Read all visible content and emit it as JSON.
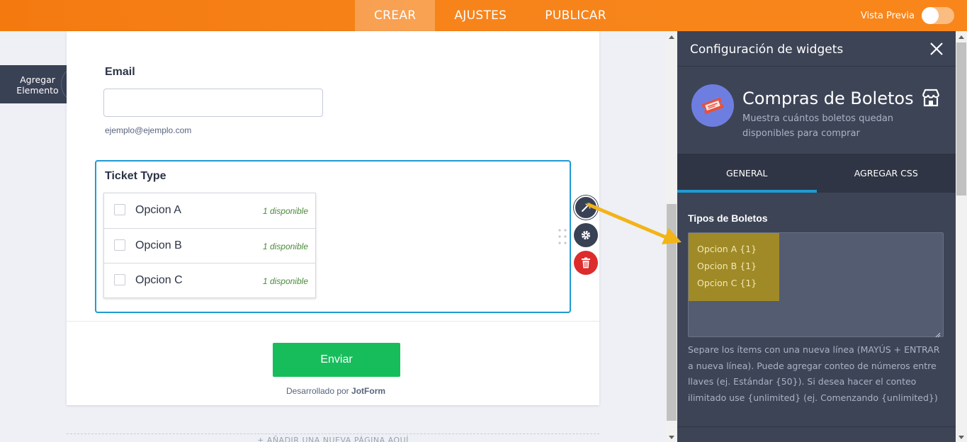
{
  "topbar": {
    "tabs": [
      {
        "label": "CREAR",
        "active": true
      },
      {
        "label": "AJUSTES",
        "active": false
      },
      {
        "label": "PUBLICAR",
        "active": false
      }
    ],
    "preview_label": "Vista Previa",
    "preview_enabled": false,
    "accent": "#f47a10"
  },
  "add_element": {
    "line1": "Agregar",
    "line2": "Elemento",
    "icon": "plus-icon"
  },
  "form": {
    "email": {
      "label": "Email",
      "value": "",
      "hint": "ejemplo@ejemplo.com"
    },
    "ticket": {
      "label": "Ticket Type",
      "options": [
        {
          "label": "Opcion A",
          "availability": "1 disponible",
          "checked": false
        },
        {
          "label": "Opcion B",
          "availability": "1 disponible",
          "checked": false
        },
        {
          "label": "Opcion C",
          "availability": "1 disponible",
          "checked": false
        }
      ]
    },
    "submit_label": "Enviar",
    "submit_color": "#18bd5b",
    "powered_prefix": "Desarrollado por",
    "powered_brand": "JotForm",
    "new_page": "+ AÑADIR UNA NUEVA PÁGINA AQUÍ",
    "tools": [
      "wand-icon",
      "gear-icon",
      "trash-icon"
    ]
  },
  "panel": {
    "title": "Configuración de widgets",
    "close_icon": "close-icon",
    "widget": {
      "name": "Compras de Boletos",
      "description": "Muestra cuántos boletos quedan disponibles para comprar",
      "icon": "ticket-icon",
      "store_icon": "store-icon",
      "icon_color": "#6e7ee0"
    },
    "tabs": [
      {
        "label": "GENERAL",
        "active": true
      },
      {
        "label": "AGREGAR CSS",
        "active": false
      }
    ],
    "field_label": "Tipos de Boletos",
    "textarea_lines": [
      "Opcion A {1}",
      "Opcion B {1}",
      "Opcion C {1}"
    ],
    "help": "Separe los ítems con una nueva línea (MAYÚS + ENTRAR a nueva línea). Puede agregar conteo de números entre llaves (ej. Estándar {50}). Si desea hacer el conteo ilimitado use {unlimited} (ej. Comenzando {unlimited})",
    "tab_indicator_color": "#1f9bd2"
  }
}
